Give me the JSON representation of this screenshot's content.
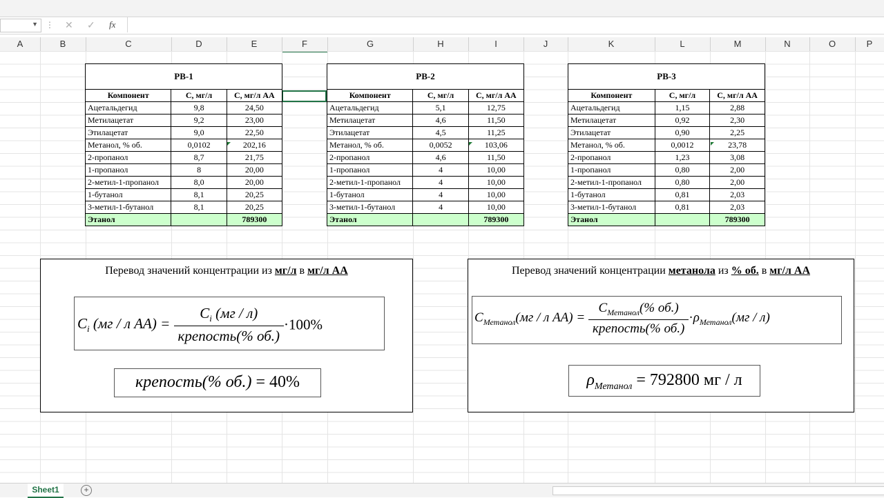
{
  "formula_bar": {
    "name_box": "",
    "cancel_icon": "✕",
    "enter_icon": "✓",
    "fx_label": "fx",
    "value": ""
  },
  "columns": [
    "A",
    "B",
    "C",
    "D",
    "E",
    "F",
    "G",
    "H",
    "I",
    "J",
    "K",
    "L",
    "M",
    "N",
    "O",
    "P"
  ],
  "tables": [
    {
      "title": "РВ-1",
      "headers": [
        "Компонент",
        "С, мг/л",
        "С, мг/л АА"
      ],
      "rows": [
        [
          "Ацетальдегид",
          "9,8",
          "24,50"
        ],
        [
          "Метилацетат",
          "9,2",
          "23,00"
        ],
        [
          "Этилацетат",
          "9,0",
          "22,50"
        ],
        [
          "Метанол, % об.",
          "0,0102",
          "202,16"
        ],
        [
          "2-пропанол",
          "8,7",
          "21,75"
        ],
        [
          "1-пропанол",
          "8",
          "20,00"
        ],
        [
          "2-метил-1-пропанол",
          "8,0",
          "20,00"
        ],
        [
          "1-бутанол",
          "8,1",
          "20,25"
        ],
        [
          "3-метил-1-бутанол",
          "8,1",
          "20,25"
        ]
      ],
      "ethanol": {
        "label": "Этанол",
        "value": "789300"
      }
    },
    {
      "title": "РВ-2",
      "headers": [
        "Компонент",
        "С, мг/л",
        "С, мг/л АА"
      ],
      "rows": [
        [
          "Ацетальдегид",
          "5,1",
          "12,75"
        ],
        [
          "Метилацетат",
          "4,6",
          "11,50"
        ],
        [
          "Этилацетат",
          "4,5",
          "11,25"
        ],
        [
          "Метанол, % об.",
          "0,0052",
          "103,06"
        ],
        [
          "2-пропанол",
          "4,6",
          "11,50"
        ],
        [
          "1-пропанол",
          "4",
          "10,00"
        ],
        [
          "2-метил-1-пропанол",
          "4",
          "10,00"
        ],
        [
          "1-бутанол",
          "4",
          "10,00"
        ],
        [
          "3-метил-1-бутанол",
          "4",
          "10,00"
        ]
      ],
      "ethanol": {
        "label": "Этанол",
        "value": "789300"
      }
    },
    {
      "title": "РВ-3",
      "headers": [
        "Компонент",
        "С, мг/л",
        "С, мг/л АА"
      ],
      "rows": [
        [
          "Ацетальдегид",
          "1,15",
          "2,88"
        ],
        [
          "Метилацетат",
          "0,92",
          "2,30"
        ],
        [
          "Этилацетат",
          "0,90",
          "2,25"
        ],
        [
          "Метанол, % об.",
          "0,0012",
          "23,78"
        ],
        [
          "2-пропанол",
          "1,23",
          "3,08"
        ],
        [
          "1-пропанол",
          "0,80",
          "2,00"
        ],
        [
          "2-метил-1-пропанол",
          "0,80",
          "2,00"
        ],
        [
          "1-бутанол",
          "0,81",
          "2,03"
        ],
        [
          "3-метил-1-бутанол",
          "0,81",
          "2,03"
        ]
      ],
      "ethanol": {
        "label": "Этанол",
        "value": "789300"
      }
    }
  ],
  "panel_left": {
    "title_pre": "Перевод значений концентрации из ",
    "title_b1": "мг/л",
    "title_mid": " в ",
    "title_b2": "мг/л АА",
    "formula": {
      "lhs_var": "C",
      "lhs_sub": "i",
      "lhs_unit": "(мг / л АА) =",
      "num_var": "C",
      "num_sub": "i",
      "num_unit": "(мг / л)",
      "den": "крепость(% об.)",
      "mult": "·100%"
    },
    "strength_var": "крепость(% об.)",
    "strength_val": "= 40%"
  },
  "panel_right": {
    "title_pre": "Перевод значений концентрации ",
    "title_b1": "метанола",
    "title_mid1": " из ",
    "title_b2": "% об.",
    "title_mid2": " в ",
    "title_b3": "мг/л АА",
    "formula": {
      "lhs_var": "C",
      "lhs_sub": "Метанол",
      "lhs_unit": "(мг / л АА) =",
      "num_var": "C",
      "num_sub": "Метанол",
      "num_unit": "(% об.)",
      "den": "крепость(% об.)",
      "dot": "·",
      "rho": "ρ",
      "rho_sub": "Метанол",
      "rho_unit": "(мг / л)"
    },
    "density_var": "ρ",
    "density_sub": "Метанол",
    "density_val": "= 792800 мг / л"
  },
  "sheet_tab": "Sheet1",
  "add_sheet_icon": "+"
}
